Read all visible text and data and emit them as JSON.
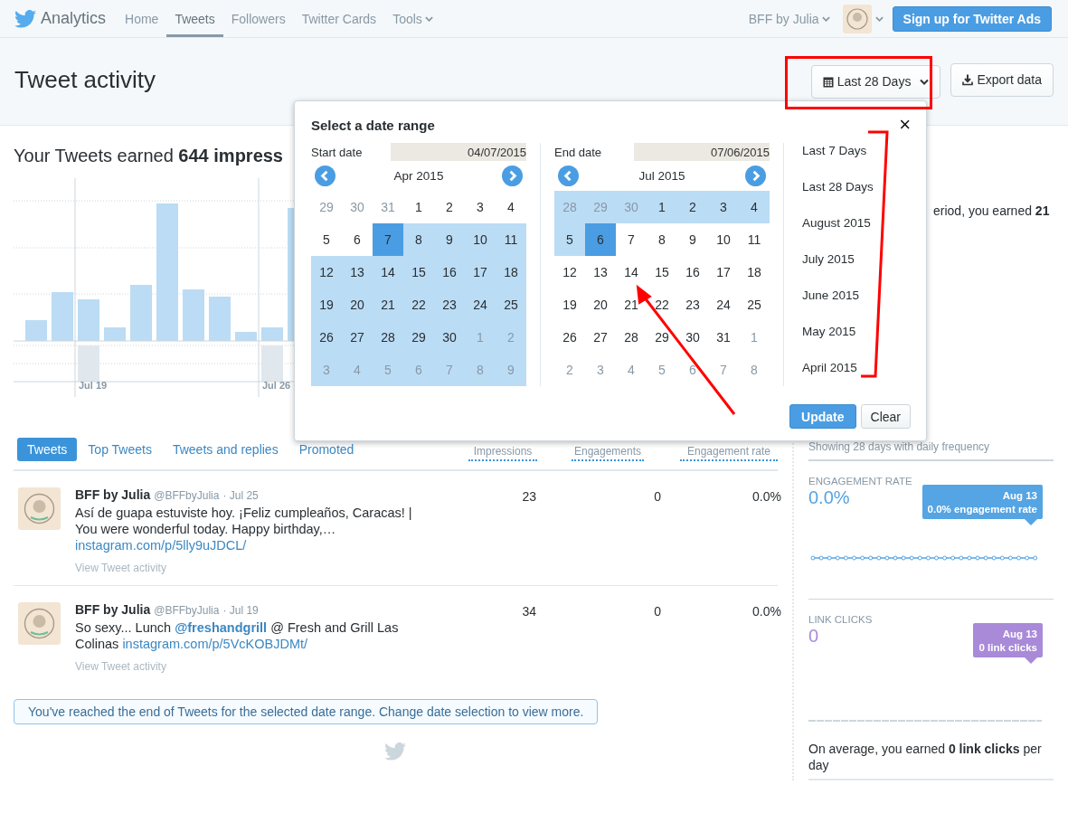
{
  "nav": {
    "brand": "Analytics",
    "items": [
      {
        "label": "Home",
        "selected": false,
        "has_menu": false
      },
      {
        "label": "Tweets",
        "selected": true,
        "has_menu": false
      },
      {
        "label": "Followers",
        "selected": false,
        "has_menu": false
      },
      {
        "label": "Twitter Cards",
        "selected": false,
        "has_menu": false
      },
      {
        "label": "Tools",
        "selected": false,
        "has_menu": true
      }
    ],
    "account": "BFF by Julia",
    "ads_button": "Sign up for Twitter Ads"
  },
  "header": {
    "title": "Tweet activity",
    "range_button": "Last 28 Days",
    "export_button": "Export data"
  },
  "summary": "Your Tweets earned **644 impress**",
  "chart_labels": [
    "Jul 19",
    "Jul 26"
  ],
  "tabs": [
    {
      "label": "Tweets",
      "selected": true
    },
    {
      "label": "Top Tweets",
      "selected": false
    },
    {
      "label": "Tweets and replies",
      "selected": false
    },
    {
      "label": "Promoted",
      "selected": false
    }
  ],
  "columns": [
    "Impressions",
    "Engagements",
    "Engagement rate"
  ],
  "tweets": [
    {
      "name": "BFF by Julia",
      "handle": "@BFFbyJulia",
      "date": "· Jul 25",
      "parts": [
        {
          "kind": "text",
          "text": "Así de guapa estuviste hoy. ¡Feliz cumpleaños, Caracas! | You were wonderful today. Happy birthday,… "
        },
        {
          "kind": "link",
          "text": "instagram.com/p/5lly9uJDCL/"
        }
      ],
      "impressions": "23",
      "engagements": "0",
      "rate": "0.0%",
      "action": "View Tweet activity"
    },
    {
      "name": "BFF by Julia",
      "handle": "@BFFbyJulia",
      "date": "· Jul 19",
      "parts": [
        {
          "kind": "text",
          "text": "So sexy... Lunch "
        },
        {
          "kind": "mention",
          "text": "@freshandgrill"
        },
        {
          "kind": "text",
          "text": " @ Fresh and Grill Las Colinas "
        },
        {
          "kind": "link",
          "text": "instagram.com/p/5VcKOBJDMt/"
        }
      ],
      "impressions": "34",
      "engagements": "0",
      "rate": "0.0%",
      "action": "View Tweet activity"
    }
  ],
  "end_note": "You've reached the end of Tweets for the selected date range. Change date selection to view more.",
  "sidebar": {
    "intro": "eriod, you earned **21**",
    "frequency": "Showing 28 days with daily frequency",
    "metrics": [
      {
        "title": "ENGAGEMENT RATE",
        "value": "0.0%",
        "tooltip_date": "Aug 13",
        "tooltip_text": "0.0% engagement rate",
        "color": "#55a4e3",
        "kind": "dotted"
      },
      {
        "title": "LINK CLICKS",
        "value": "0",
        "tooltip_date": "Aug 13",
        "tooltip_text": "0 link clicks",
        "color": "#a98ad8",
        "kind": "dashed"
      }
    ],
    "average": "On average, you earned **0 link clicks** per day"
  },
  "date_picker": {
    "title": "Select a date range",
    "close": "×",
    "calendars": [
      {
        "label": "Start date",
        "value": "04/07/2015",
        "month": "Apr 2015",
        "weeks": [
          [
            {
              "day": "29",
              "muted": true,
              "in_range": false,
              "selected": false
            },
            {
              "day": "30",
              "muted": true,
              "in_range": false,
              "selected": false
            },
            {
              "day": "31",
              "muted": true,
              "in_range": false,
              "selected": false
            },
            {
              "day": "1",
              "muted": false,
              "in_range": false,
              "selected": false
            },
            {
              "day": "2",
              "muted": false,
              "in_range": false,
              "selected": false
            },
            {
              "day": "3",
              "muted": false,
              "in_range": false,
              "selected": false
            },
            {
              "day": "4",
              "muted": false,
              "in_range": false,
              "selected": false
            }
          ],
          [
            {
              "day": "5",
              "muted": false,
              "in_range": false,
              "selected": false
            },
            {
              "day": "6",
              "muted": false,
              "in_range": false,
              "selected": false
            },
            {
              "day": "7",
              "muted": false,
              "in_range": true,
              "selected": true
            },
            {
              "day": "8",
              "muted": false,
              "in_range": true,
              "selected": false
            },
            {
              "day": "9",
              "muted": false,
              "in_range": true,
              "selected": false
            },
            {
              "day": "10",
              "muted": false,
              "in_range": true,
              "selected": false
            },
            {
              "day": "11",
              "muted": false,
              "in_range": true,
              "selected": false
            }
          ],
          [
            {
              "day": "12",
              "muted": false,
              "in_range": true,
              "selected": false
            },
            {
              "day": "13",
              "muted": false,
              "in_range": true,
              "selected": false
            },
            {
              "day": "14",
              "muted": false,
              "in_range": true,
              "selected": false
            },
            {
              "day": "15",
              "muted": false,
              "in_range": true,
              "selected": false
            },
            {
              "day": "16",
              "muted": false,
              "in_range": true,
              "selected": false
            },
            {
              "day": "17",
              "muted": false,
              "in_range": true,
              "selected": false
            },
            {
              "day": "18",
              "muted": false,
              "in_range": true,
              "selected": false
            }
          ],
          [
            {
              "day": "19",
              "muted": false,
              "in_range": true,
              "selected": false
            },
            {
              "day": "20",
              "muted": false,
              "in_range": true,
              "selected": false
            },
            {
              "day": "21",
              "muted": false,
              "in_range": true,
              "selected": false
            },
            {
              "day": "22",
              "muted": false,
              "in_range": true,
              "selected": false
            },
            {
              "day": "23",
              "muted": false,
              "in_range": true,
              "selected": false
            },
            {
              "day": "24",
              "muted": false,
              "in_range": true,
              "selected": false
            },
            {
              "day": "25",
              "muted": false,
              "in_range": true,
              "selected": false
            }
          ],
          [
            {
              "day": "26",
              "muted": false,
              "in_range": true,
              "selected": false
            },
            {
              "day": "27",
              "muted": false,
              "in_range": true,
              "selected": false
            },
            {
              "day": "28",
              "muted": false,
              "in_range": true,
              "selected": false
            },
            {
              "day": "29",
              "muted": false,
              "in_range": true,
              "selected": false
            },
            {
              "day": "30",
              "muted": false,
              "in_range": true,
              "selected": false
            },
            {
              "day": "1",
              "muted": true,
              "in_range": true,
              "selected": false
            },
            {
              "day": "2",
              "muted": true,
              "in_range": true,
              "selected": false
            }
          ],
          [
            {
              "day": "3",
              "muted": true,
              "in_range": true,
              "selected": false
            },
            {
              "day": "4",
              "muted": true,
              "in_range": true,
              "selected": false
            },
            {
              "day": "5",
              "muted": true,
              "in_range": true,
              "selected": false
            },
            {
              "day": "6",
              "muted": true,
              "in_range": true,
              "selected": false
            },
            {
              "day": "7",
              "muted": true,
              "in_range": true,
              "selected": false
            },
            {
              "day": "8",
              "muted": true,
              "in_range": true,
              "selected": false
            },
            {
              "day": "9",
              "muted": true,
              "in_range": true,
              "selected": false
            }
          ]
        ]
      },
      {
        "label": "End date",
        "value": "07/06/2015",
        "month": "Jul 2015",
        "weeks": [
          [
            {
              "day": "28",
              "muted": true,
              "in_range": true,
              "selected": false
            },
            {
              "day": "29",
              "muted": true,
              "in_range": true,
              "selected": false
            },
            {
              "day": "30",
              "muted": true,
              "in_range": true,
              "selected": false
            },
            {
              "day": "1",
              "muted": false,
              "in_range": true,
              "selected": false
            },
            {
              "day": "2",
              "muted": false,
              "in_range": true,
              "selected": false
            },
            {
              "day": "3",
              "muted": false,
              "in_range": true,
              "selected": false
            },
            {
              "day": "4",
              "muted": false,
              "in_range": true,
              "selected": false
            }
          ],
          [
            {
              "day": "5",
              "muted": false,
              "in_range": true,
              "selected": false
            },
            {
              "day": "6",
              "muted": false,
              "in_range": true,
              "selected": true
            },
            {
              "day": "7",
              "muted": false,
              "in_range": false,
              "selected": false
            },
            {
              "day": "8",
              "muted": false,
              "in_range": false,
              "selected": false
            },
            {
              "day": "9",
              "muted": false,
              "in_range": false,
              "selected": false
            },
            {
              "day": "10",
              "muted": false,
              "in_range": false,
              "selected": false
            },
            {
              "day": "11",
              "muted": false,
              "in_range": false,
              "selected": false
            }
          ],
          [
            {
              "day": "12",
              "muted": false,
              "in_range": false,
              "selected": false
            },
            {
              "day": "13",
              "muted": false,
              "in_range": false,
              "selected": false
            },
            {
              "day": "14",
              "muted": false,
              "in_range": false,
              "selected": false
            },
            {
              "day": "15",
              "muted": false,
              "in_range": false,
              "selected": false
            },
            {
              "day": "16",
              "muted": false,
              "in_range": false,
              "selected": false
            },
            {
              "day": "17",
              "muted": false,
              "in_range": false,
              "selected": false
            },
            {
              "day": "18",
              "muted": false,
              "in_range": false,
              "selected": false
            }
          ],
          [
            {
              "day": "19",
              "muted": false,
              "in_range": false,
              "selected": false
            },
            {
              "day": "20",
              "muted": false,
              "in_range": false,
              "selected": false
            },
            {
              "day": "21",
              "muted": false,
              "in_range": false,
              "selected": false
            },
            {
              "day": "22",
              "muted": false,
              "in_range": false,
              "selected": false
            },
            {
              "day": "23",
              "muted": false,
              "in_range": false,
              "selected": false
            },
            {
              "day": "24",
              "muted": false,
              "in_range": false,
              "selected": false
            },
            {
              "day": "25",
              "muted": false,
              "in_range": false,
              "selected": false
            }
          ],
          [
            {
              "day": "26",
              "muted": false,
              "in_range": false,
              "selected": false
            },
            {
              "day": "27",
              "muted": false,
              "in_range": false,
              "selected": false
            },
            {
              "day": "28",
              "muted": false,
              "in_range": false,
              "selected": false
            },
            {
              "day": "29",
              "muted": false,
              "in_range": false,
              "selected": false
            },
            {
              "day": "30",
              "muted": false,
              "in_range": false,
              "selected": false
            },
            {
              "day": "31",
              "muted": false,
              "in_range": false,
              "selected": false
            },
            {
              "day": "1",
              "muted": true,
              "in_range": false,
              "selected": false
            }
          ],
          [
            {
              "day": "2",
              "muted": true,
              "in_range": false,
              "selected": false
            },
            {
              "day": "3",
              "muted": true,
              "in_range": false,
              "selected": false
            },
            {
              "day": "4",
              "muted": true,
              "in_range": false,
              "selected": false
            },
            {
              "day": "5",
              "muted": true,
              "in_range": false,
              "selected": false
            },
            {
              "day": "6",
              "muted": true,
              "in_range": false,
              "selected": false
            },
            {
              "day": "7",
              "muted": true,
              "in_range": false,
              "selected": false
            },
            {
              "day": "8",
              "muted": true,
              "in_range": false,
              "selected": false
            }
          ]
        ]
      }
    ],
    "presets": [
      "Last 7 Days",
      "Last 28 Days",
      "August 2015",
      "July 2015",
      "June 2015",
      "May 2015",
      "April 2015"
    ],
    "update_button": "Update",
    "clear_button": "Clear"
  }
}
